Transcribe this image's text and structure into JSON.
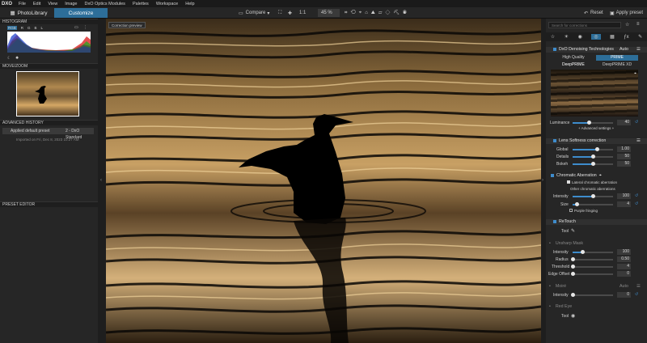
{
  "menubar": {
    "logo": "DXO",
    "items": [
      "File",
      "Edit",
      "View",
      "Image",
      "DxO Optics Modules",
      "Palettes",
      "Workspace",
      "Help"
    ]
  },
  "toolbar": {
    "tab_library": "PhotoLibrary",
    "tab_customize": "Customize",
    "compare": "Compare",
    "ratio": "1:1",
    "zoom": "45 %",
    "reset": "Reset",
    "apply_preset": "Apply preset"
  },
  "left": {
    "histogram_title": "HISTOGRAM",
    "channels": [
      "RGB",
      "R",
      "G",
      "B",
      "L"
    ],
    "movezoom_title": "MOVE/ZOOM",
    "history_title": "ADVANCED HISTORY",
    "history_item": "Applied default preset",
    "history_value": "2 - DxO Standard",
    "imported": "Imported on Fri, Dec 8, 2023 10:27 AM",
    "preset_title": "PRESET EDITOR"
  },
  "center": {
    "correction_preview": "Correction preview"
  },
  "right": {
    "search_placeholder": "Search for corrections",
    "denoise": {
      "title": "DxO Denoising Technologies",
      "mode": "Auto",
      "hq": "High Quality",
      "prime": "PRIME",
      "deepprime": "DeepPRIME",
      "deepprimexd": "DeepPRIME XD",
      "luminance_label": "Luminance",
      "luminance_value": "40",
      "advanced": "+ Advanced settings +",
      "luminance_pct": 0.4
    },
    "lens": {
      "title": "Lens Softness correction",
      "rows": [
        {
          "label": "Global",
          "value": "1.00",
          "pct": 0.6
        },
        {
          "label": "Details",
          "value": "50",
          "pct": 0.5
        },
        {
          "label": "Bokeh",
          "value": "50",
          "pct": 0.5
        }
      ]
    },
    "chroma": {
      "title": "Chromatic Aberration",
      "lateral": "Lateral chromatic aberration",
      "other": "Other chromatic aberrations",
      "rows": [
        {
          "label": "Intensity",
          "value": "100",
          "pct": 0.5
        },
        {
          "label": "Size",
          "value": "4",
          "pct": 0.1
        }
      ],
      "purple": "Purple fringing"
    },
    "retouch": {
      "title": "ReTouch",
      "tool": "Tool"
    },
    "unsharp": {
      "title": "Unsharp Mask",
      "rows": [
        {
          "label": "Intensity",
          "value": "100",
          "pct": 0.25
        },
        {
          "label": "Radius",
          "value": "0.50",
          "pct": 0.0
        },
        {
          "label": "Threshold",
          "value": "4",
          "pct": 0.0
        },
        {
          "label": "Edge Offset",
          "value": "0",
          "pct": 0.0
        }
      ]
    },
    "moire": {
      "title": "Moiré",
      "mode": "Auto",
      "intensity_label": "Intensity",
      "intensity_value": "0",
      "intensity_pct": 0
    },
    "redeye": {
      "title": "Red Eye",
      "tool": "Tool"
    }
  }
}
